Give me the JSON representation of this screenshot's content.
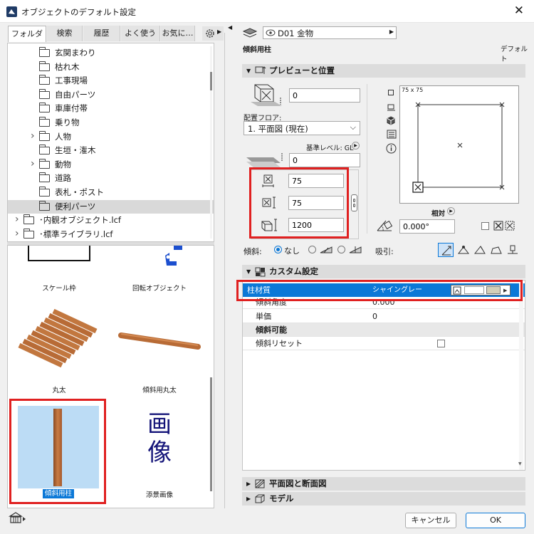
{
  "window": {
    "title": "オブジェクトのデフォルト設定",
    "close": "✕"
  },
  "tabs": [
    {
      "label": "フォルダ",
      "active": true
    },
    {
      "label": "検索",
      "active": false
    },
    {
      "label": "履歴",
      "active": false
    },
    {
      "label": "よく使う",
      "active": false
    },
    {
      "label": "お気に…",
      "active": false
    }
  ],
  "tree": {
    "items": [
      {
        "label": "玄関まわり",
        "expand": false
      },
      {
        "label": "枯れ木",
        "expand": false
      },
      {
        "label": "工事現場",
        "expand": false
      },
      {
        "label": "自由パーツ",
        "expand": false
      },
      {
        "label": "車庫付帯",
        "expand": false
      },
      {
        "label": "乗り物",
        "expand": false
      },
      {
        "label": "人物",
        "expand": true
      },
      {
        "label": "生垣・潅木",
        "expand": false
      },
      {
        "label": "動物",
        "expand": true
      },
      {
        "label": "道路",
        "expand": false
      },
      {
        "label": "表札・ポスト",
        "expand": false
      },
      {
        "label": "便利パーツ",
        "expand": false,
        "selected": true
      }
    ],
    "roots": [
      {
        "label": "･内観オブジェクト.lcf"
      },
      {
        "label": "･標準ライブラリ.lcf"
      }
    ]
  },
  "gallery": {
    "items": [
      {
        "label": "スケール枠"
      },
      {
        "label": "回転オブジェクト"
      },
      {
        "label": "丸太"
      },
      {
        "label": "傾斜用丸太"
      },
      {
        "label": "傾斜用柱",
        "selected": true
      },
      {
        "label": "添景画像"
      }
    ],
    "image_glyphs": [
      "画",
      "像"
    ]
  },
  "header": {
    "object_name": "D01 金物",
    "current_label": "傾斜用柱",
    "default_label": "デフォルト"
  },
  "preview_section": {
    "title": "プレビューと位置",
    "elevation": "0",
    "floor_label": "配置フロア:",
    "floor_value": "1. 平面図 (現在)",
    "base_level_label": "基準レベル: GL",
    "base_offset": "0",
    "width": "75",
    "depth": "75",
    "height": "1200",
    "preview_size_label": "75 x 75",
    "relative_label": "相対",
    "angle": "0.000°",
    "tilt_label": "傾斜:",
    "tilt_none": "なし",
    "snap_label": "吸引:"
  },
  "custom_section": {
    "title": "カスタム設定",
    "rows": [
      {
        "name": "柱材質",
        "value": "シャイングレー",
        "selected": true
      },
      {
        "name": "傾斜角度",
        "value": "0.000"
      },
      {
        "name": "単価",
        "value": "0"
      },
      {
        "name": "傾斜可能",
        "value": "",
        "group": true
      },
      {
        "name": "傾斜リセット",
        "value": "",
        "checkbox": true
      }
    ],
    "swatch_color": "#d4cfb8"
  },
  "collapsed_sections": [
    {
      "title": "平面図と断面図"
    },
    {
      "title": "モデル"
    }
  ],
  "footer": {
    "cancel": "キャンセル",
    "ok": "OK"
  },
  "colors": {
    "selection_blue": "#0b78d7",
    "highlight_red": "#e02020",
    "tile_blue": "#bcdcf5",
    "wood": "#b4683a"
  }
}
